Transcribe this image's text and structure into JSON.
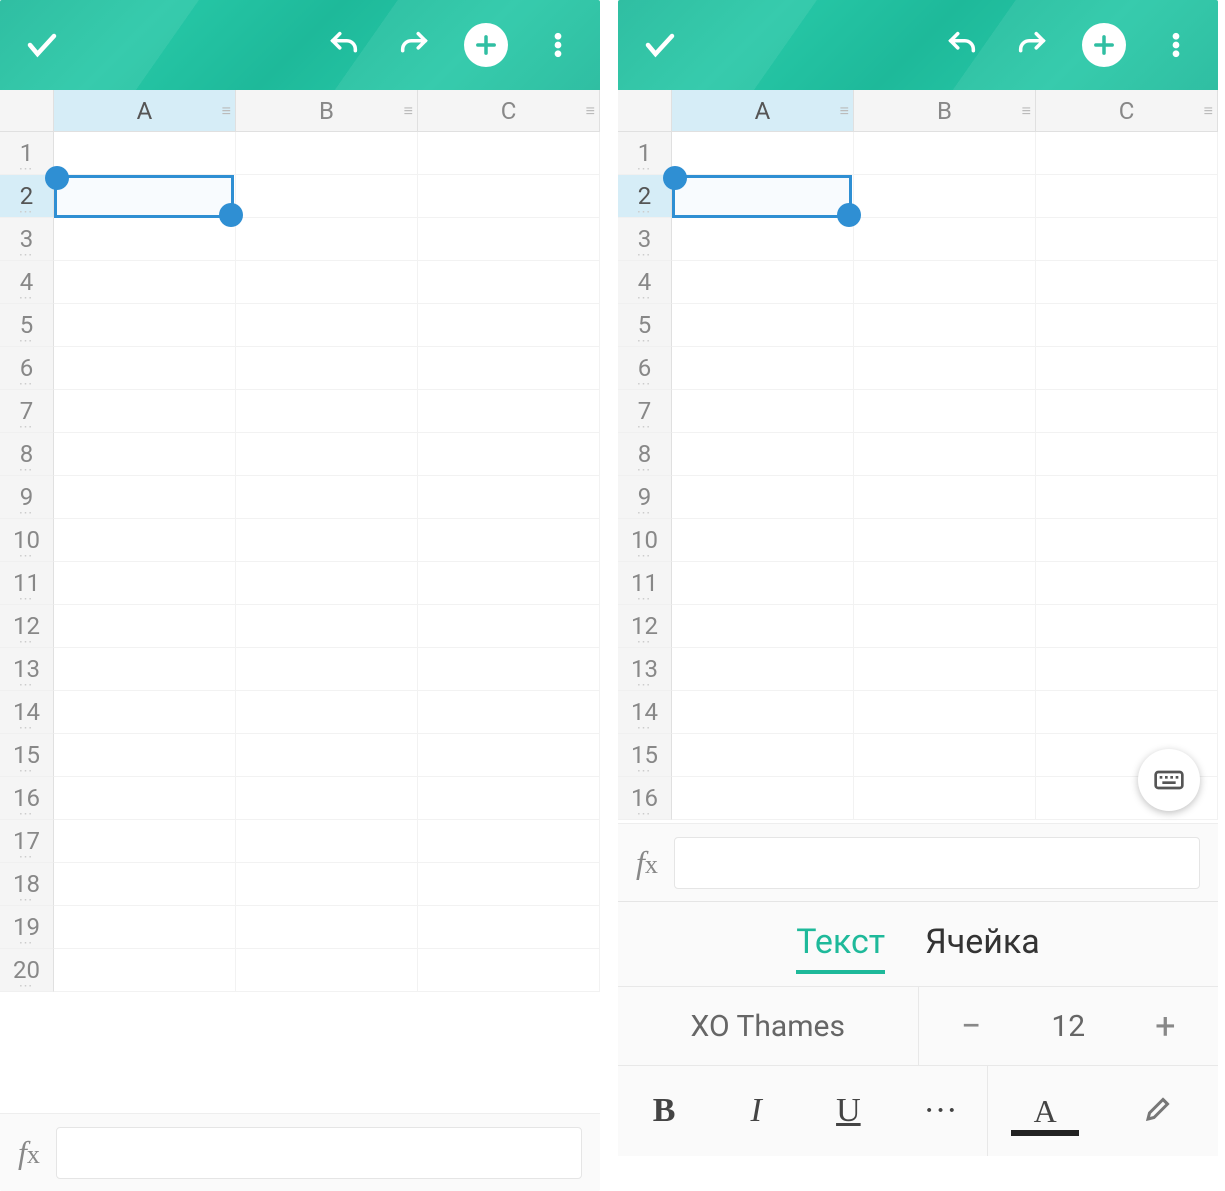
{
  "toolbar": {
    "confirm_icon": "check",
    "undo_icon": "undo",
    "redo_icon": "redo",
    "add_icon": "plus",
    "menu_icon": "more-vert"
  },
  "sheet": {
    "columns": [
      "A",
      "B",
      "C"
    ],
    "selected_column_index": 0,
    "selected_row_index": 1,
    "selected_cell": "A2",
    "left": {
      "rows": [
        "1",
        "2",
        "3",
        "4",
        "5",
        "6",
        "7",
        "8",
        "9",
        "10",
        "11",
        "12",
        "13",
        "14",
        "15",
        "16",
        "17",
        "18",
        "19",
        "20"
      ]
    },
    "right": {
      "rows": [
        "1",
        "2",
        "3",
        "4",
        "5",
        "6",
        "7",
        "8",
        "9",
        "10",
        "11",
        "12",
        "13",
        "14",
        "15",
        "16"
      ]
    }
  },
  "fx": {
    "label_f": "f",
    "label_x": "x",
    "value": ""
  },
  "panel": {
    "tabs": {
      "text": "Текст",
      "cell": "Ячейка",
      "active": "text"
    },
    "font_name": "XO Thames",
    "font_size": "12",
    "minus": "−",
    "plus": "+",
    "bold": "B",
    "italic": "I",
    "underline": "U",
    "more": "···",
    "text_color_letter": "A"
  },
  "keyboard_fab_icon": "keyboard"
}
